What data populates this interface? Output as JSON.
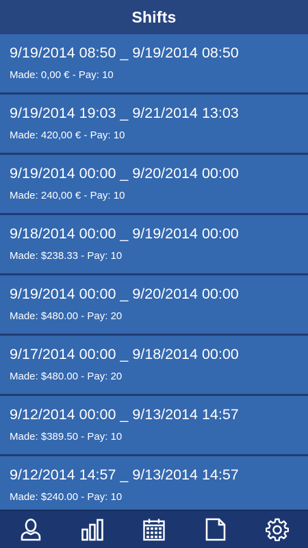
{
  "header": {
    "title": "Shifts"
  },
  "shifts": [
    {
      "range": "9/19/2014 08:50 _ 9/19/2014 08:50",
      "detail": "Made: 0,00 € - Pay: 10"
    },
    {
      "range": "9/19/2014 19:03 _ 9/21/2014 13:03",
      "detail": "Made: 420,00 € - Pay: 10"
    },
    {
      "range": "9/19/2014 00:00 _ 9/20/2014 00:00",
      "detail": "Made: 240,00 € - Pay: 10"
    },
    {
      "range": "9/18/2014 00:00 _ 9/19/2014 00:00",
      "detail": "Made: $238.33 - Pay: 10"
    },
    {
      "range": "9/19/2014 00:00 _ 9/20/2014 00:00",
      "detail": "Made: $480.00 - Pay: 20"
    },
    {
      "range": "9/17/2014 00:00 _ 9/18/2014 00:00",
      "detail": "Made: $480.00 - Pay: 20"
    },
    {
      "range": "9/12/2014 00:00 _ 9/13/2014 14:57",
      "detail": "Made: $389.50 - Pay: 10"
    },
    {
      "range": "9/12/2014 14:57 _ 9/13/2014 14:57",
      "detail": "Made: $240.00 - Pay: 10"
    }
  ],
  "bottom_nav": {
    "items": [
      {
        "icon": "user-icon"
      },
      {
        "icon": "bar-chart-icon"
      },
      {
        "icon": "calendar-icon"
      },
      {
        "icon": "document-icon"
      },
      {
        "icon": "gear-icon"
      }
    ]
  },
  "colors": {
    "header_bg": "#27457f",
    "item_bg": "#3468af",
    "separator": "#203c72",
    "nav_bg": "#1c3770",
    "text": "#ffffff"
  }
}
